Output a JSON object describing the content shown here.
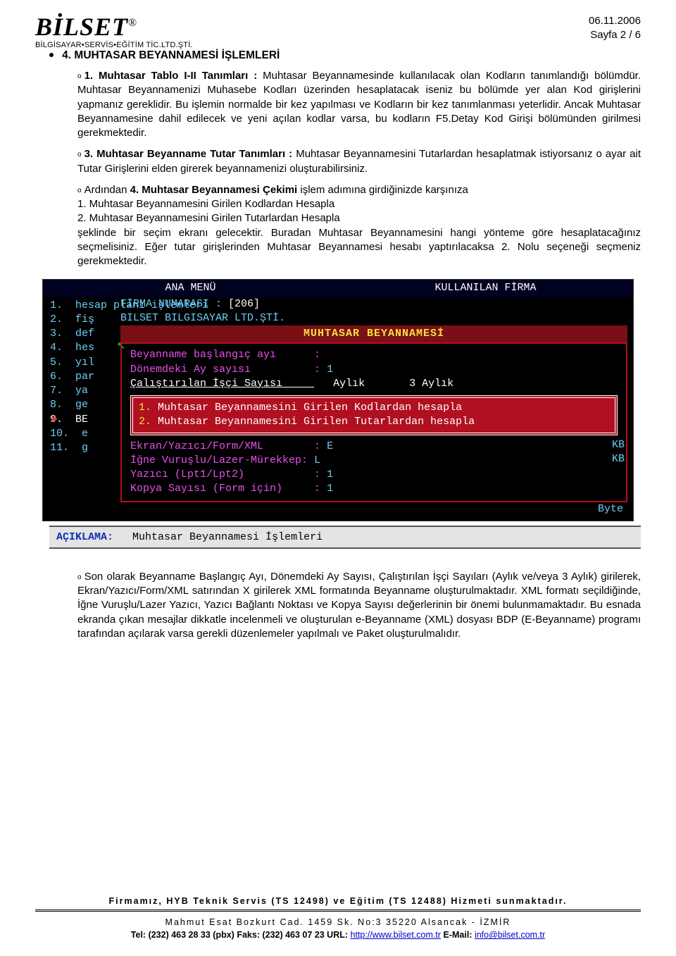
{
  "header": {
    "logo_title": "BİLSET",
    "logo_reg": "®",
    "logo_sub": "BİLGİSAYAR•SERVİS•EĞİTİM TİC.LTD.ŞTİ.",
    "date": "06.11.2006",
    "page": "Sayfa 2 / 6"
  },
  "section_title": "4. MUHTASAR BEYANNAMESİ İŞLEMLERİ",
  "p1_lead": "1. Muhtasar Tablo I-II Tanımları :",
  "p1_body": " Muhtasar Beyannamesinde kullanılacak olan Kodların tanımlandığı bölümdür. Muhtasar Beyannamenizi Muhasebe Kodları üzerinden hesaplatacak iseniz bu bölümde yer alan Kod girişlerini yapmanız gereklidir. Bu işlemin normalde bir kez yapılması ve Kodların bir kez tanımlanması yeterlidir. Ancak Muhtasar Beyannamesine dahil edilecek ve yeni açılan kodlar varsa, bu kodların F5.Detay Kod Girişi bölümünden girilmesi gerekmektedir.",
  "p2_lead": "3. Muhtasar Beyanname Tutar Tanımları :",
  "p2_body": " Muhtasar Beyannamesini Tutarlardan hesaplatmak istiyorsanız o ayar ait Tutar Girişlerini elden girerek beyannamenizi oluşturabilirsiniz.",
  "p3_pre": "Ardından ",
  "p3_bold": "4. Muhtasar Beyannamesi Çekimi",
  "p3_post": " işlem adımına girdiğinizde karşınıza",
  "p3_line1": "1. Muhtasar Beyannamesini Girilen Kodlardan Hesapla",
  "p3_line2": "2. Muhtasar Beyannamesini Girilen Tutarlardan Hesapla",
  "p3_tail": "şeklinde bir seçim ekranı gelecektir. Buradan Muhtasar Beyannamesini hangi yönteme göre hesaplatacağınız seçmelisiniz. Eğer tutar girişlerinden Muhtasar Beyannamesi hesabı yaptırılacaksa 2. Nolu seçeneği seçmeniz gerekmektedir.",
  "terminal": {
    "head_left": "ANA MENÜ",
    "head_right": "KULLANILAN FİRMA",
    "firma_no_label": "FİRMA NUMARASI   :",
    "firma_no_val": "[206]",
    "firma_name": "BILSET BILGISAYAR LTD.ŞTİ.",
    "menu": [
      "1.  hesap planı işlemleri",
      "2.  fiş",
      "3.  def",
      "4.  hes",
      "5.  yıl",
      "6.  par",
      "7.  ya",
      "8.  ge",
      "9.  BE",
      "10.  e",
      "11.  g"
    ],
    "panel_title": "MUHTASAR BEYANNAMESİ",
    "f_bas_label": "Beyanname başlangıç ayı      :",
    "f_ay_label": "Dönemdeki Ay sayısı          :",
    "f_ay_val": "1",
    "f_isci_label": "Çalıştırılan İşçi Sayısı     ",
    "f_isci_a": "Aylık",
    "f_isci_b": "3 Aylık",
    "opt1_num": "1.",
    "opt1_txt": " Muhtasar Beyannamesini Girilen Kodlardan hesapla",
    "opt2_num": "2.",
    "opt2_txt": " Muhtasar Beyannamesini Girilen Tutarlardan hesapla",
    "f_ekran_lbl": "Ekran/Yazıcı/Form/XML        :",
    "f_ekran_val": "E",
    "f_igne_lbl": "İğne Vuruşlu/Lazer-Mürekkep:",
    "f_igne_val": "L",
    "f_yaz_lbl": "Yazıcı (Lpt1/Lpt2)           :",
    "f_yaz_val": "1",
    "f_kopya_lbl": "Kopya Sayısı (Form için)     :",
    "f_kopya_val": "1",
    "kb1": "KB",
    "kb2": "KB",
    "byte": "Byte"
  },
  "explain_label": "AÇIKLAMA:",
  "explain_text": "Muhtasar Beyannamesi İşlemleri",
  "p4": "Son olarak Beyanname Başlangıç Ayı, Dönemdeki Ay Sayısı, Çalıştırılan İşçi Sayıları (Aylık ve/veya 3 Aylık) girilerek, Ekran/Yazıcı/Form/XML satırından X girilerek XML formatında Beyanname oluşturulmaktadır. XML formatı seçildiğinde, İğne Vuruşlu/Lazer Yazıcı, Yazıcı Bağlantı Noktası ve Kopya Sayısı değerlerinin bir önemi bulunmamaktadır. Bu esnada ekranda çıkan mesajlar dikkatle incelenmeli ve oluşturulan e-Beyanname (XML) dosyası BDP (E-Beyanname) programı tarafından açılarak varsa gerekli düzenlemeler yapılmalı ve Paket oluşturulmalıdır.",
  "footer": {
    "l1": "Firmamız, HYB Teknik Servis (TS 12498) ve Eğitim (TS 12488) Hizmeti sunmaktadır.",
    "l2": "Mahmut Esat Bozkurt Cad. 1459 Sk. No:3 35220 Alsancak - İZMİR",
    "l3_pre": "Tel: (232) 463 28 33 (pbx) Faks: (232) 463 07 23 URL: ",
    "l3_url": "http://www.bilset.com.tr",
    "l3_mid": " E-Mail: ",
    "l3_mail": "info@bilset.com.tr"
  }
}
